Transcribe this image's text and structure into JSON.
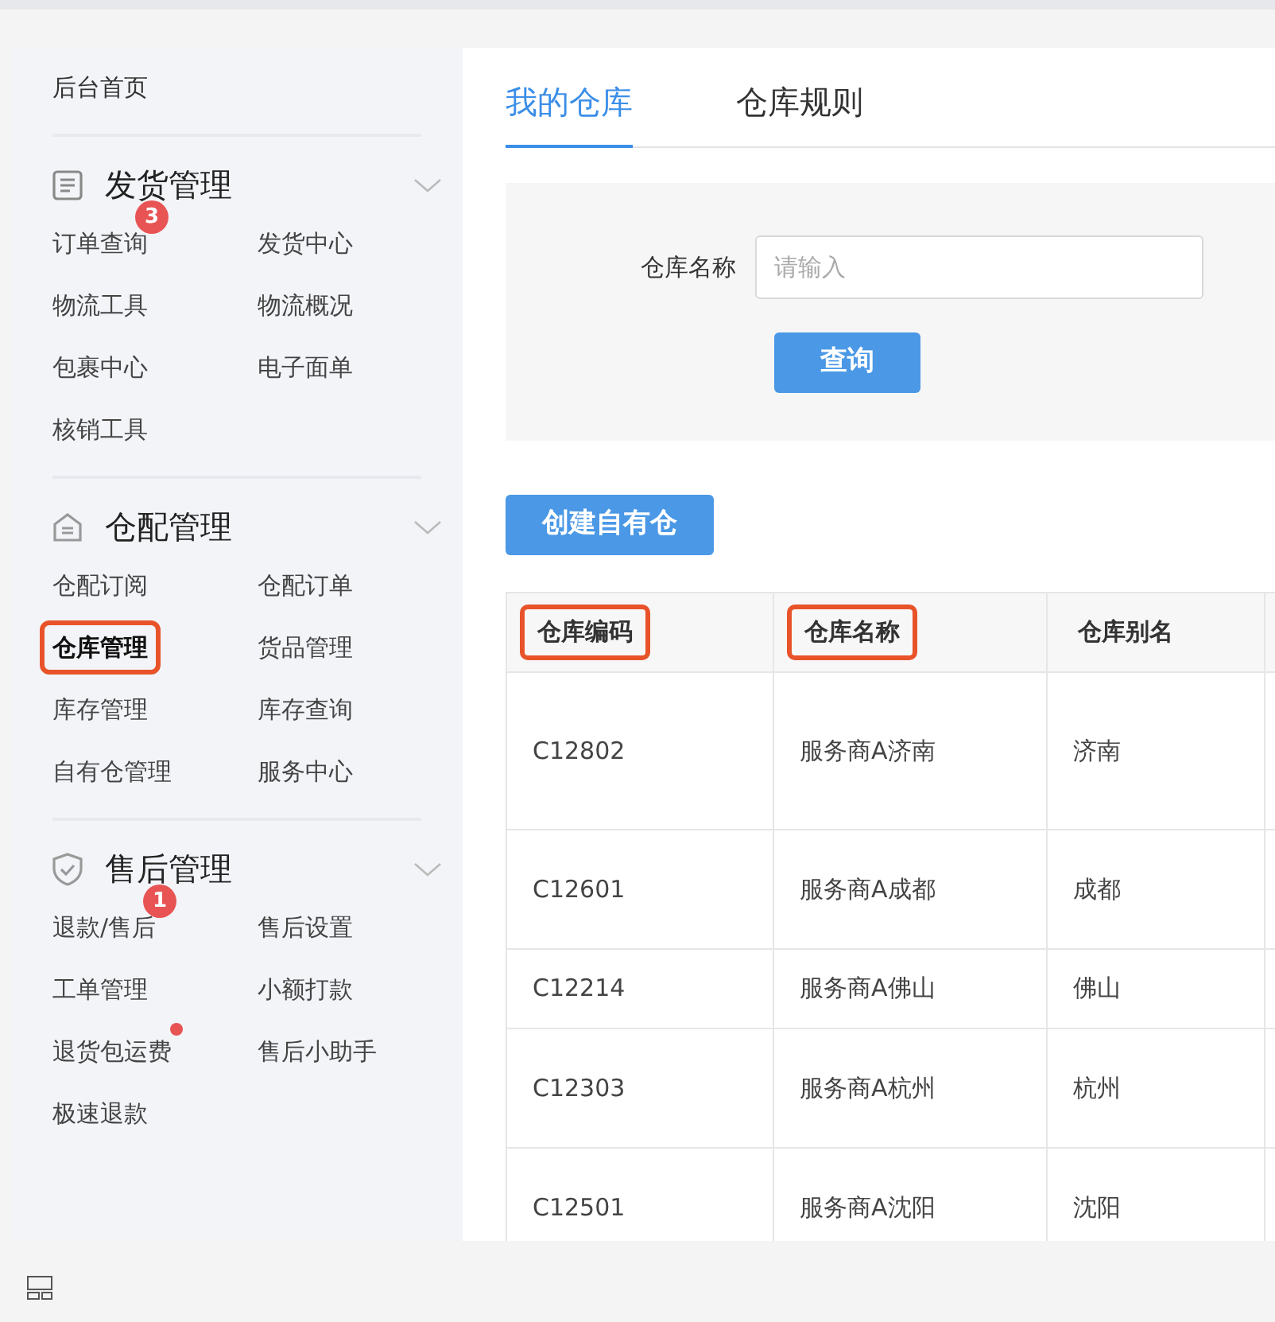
{
  "sidebar": {
    "home": "后台首页",
    "sections": [
      {
        "title": "发货管理",
        "expanded": true,
        "items": [
          {
            "label": "订单查询",
            "badge": "3",
            "dot": false,
            "highlighted": false
          },
          {
            "label": "发货中心",
            "dot": false,
            "highlighted": false
          },
          {
            "label": "物流工具",
            "dot": false,
            "highlighted": false
          },
          {
            "label": "物流概况",
            "dot": false,
            "highlighted": false
          },
          {
            "label": "包裹中心",
            "dot": false,
            "highlighted": false
          },
          {
            "label": "电子面单",
            "dot": false,
            "highlighted": false
          },
          {
            "label": "核销工具",
            "dot": false,
            "highlighted": false
          }
        ]
      },
      {
        "title": "仓配管理",
        "expanded": true,
        "items": [
          {
            "label": "仓配订阅",
            "dot": false,
            "highlighted": false
          },
          {
            "label": "仓配订单",
            "dot": false,
            "highlighted": false
          },
          {
            "label": "仓库管理",
            "dot": false,
            "highlighted": true
          },
          {
            "label": "货品管理",
            "dot": false,
            "highlighted": false
          },
          {
            "label": "库存管理",
            "dot": false,
            "highlighted": false
          },
          {
            "label": "库存查询",
            "dot": false,
            "highlighted": false
          },
          {
            "label": "自有仓管理",
            "dot": false,
            "highlighted": false
          },
          {
            "label": "服务中心",
            "dot": false,
            "highlighted": false
          }
        ]
      },
      {
        "title": "售后管理",
        "expanded": true,
        "items": [
          {
            "label": "退款/售后",
            "badge": "1",
            "dot": false,
            "highlighted": false
          },
          {
            "label": "售后设置",
            "dot": false,
            "highlighted": false
          },
          {
            "label": "工单管理",
            "dot": false,
            "highlighted": false
          },
          {
            "label": "小额打款",
            "dot": false,
            "highlighted": false
          },
          {
            "label": "退货包运费",
            "dot": true,
            "highlighted": false
          },
          {
            "label": "售后小助手",
            "dot": false,
            "highlighted": false
          },
          {
            "label": "极速退款",
            "dot": false,
            "highlighted": false
          }
        ]
      }
    ]
  },
  "tabs": [
    {
      "label": "我的仓库",
      "selected": true
    },
    {
      "label": "仓库规则",
      "selected": false
    }
  ],
  "filter": {
    "label": "仓库名称",
    "placeholder": "请输入",
    "button": "查询"
  },
  "create_button": "创建自有仓",
  "table": {
    "columns": [
      {
        "label": "仓库编码",
        "highlighted": true
      },
      {
        "label": "仓库名称",
        "highlighted": true
      },
      {
        "label": "仓库别名",
        "highlighted": false
      }
    ],
    "rows": [
      [
        "C12802",
        "服务商A济南",
        "济南"
      ],
      [
        "C12601",
        "服务商A成都",
        "成都"
      ],
      [
        "C12214",
        "服务商A佛山",
        "佛山"
      ],
      [
        "C12303",
        "服务商A杭州",
        "杭州"
      ],
      [
        "C12501",
        "服务商A沈阳",
        "沈阳"
      ]
    ]
  }
}
